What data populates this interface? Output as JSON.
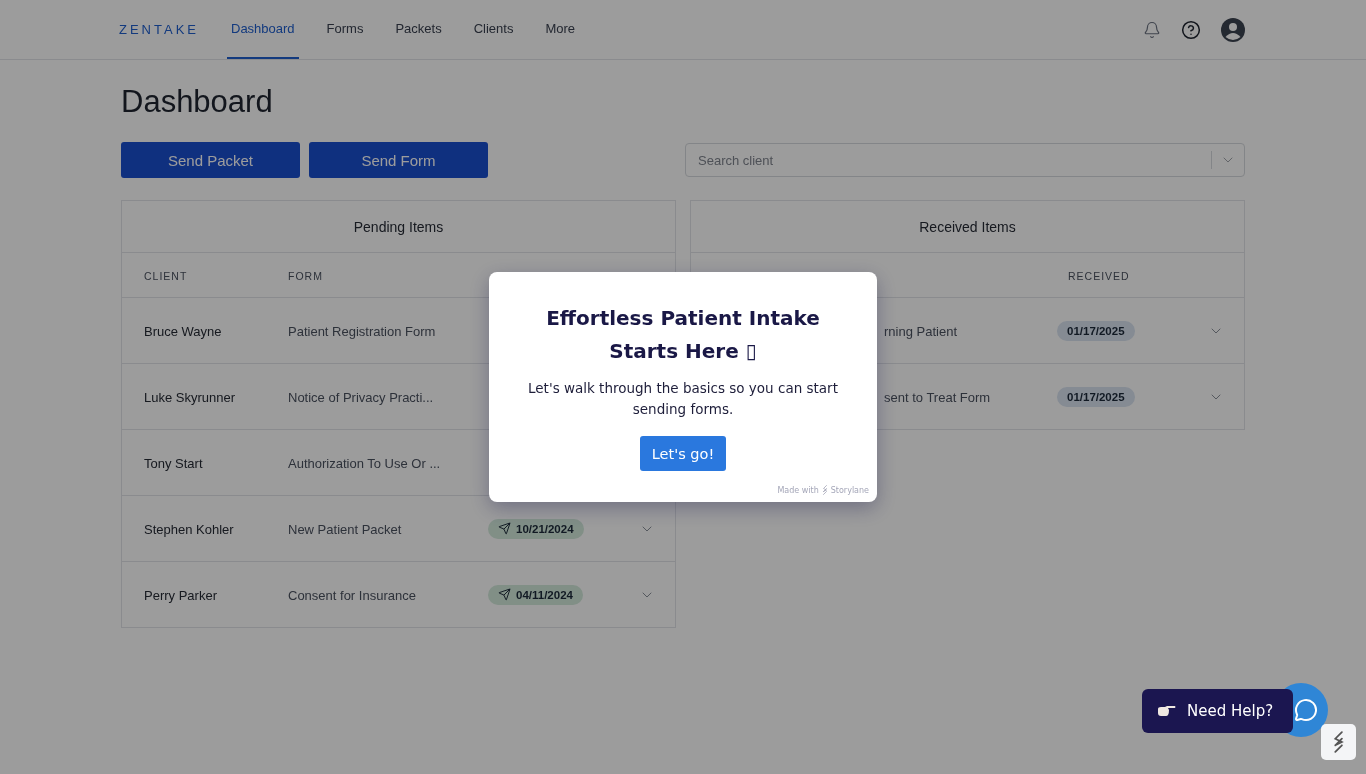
{
  "nav": {
    "logo": "ZENTAKE",
    "items": [
      {
        "label": "Dashboard",
        "selected": true
      },
      {
        "label": "Forms",
        "selected": false
      },
      {
        "label": "Packets",
        "selected": false
      },
      {
        "label": "Clients",
        "selected": false
      },
      {
        "label": "More",
        "selected": false
      }
    ]
  },
  "page_title": "Dashboard",
  "buttons": [
    "Send Packet",
    "Send Form"
  ],
  "search": {
    "placeholder": "Search client"
  },
  "pending": {
    "title": "Pending Items",
    "client_header": "CLIENT",
    "form_header": "FORM",
    "rows": [
      {
        "client": "Bruce Wayne",
        "form": "Patient Registration Form"
      },
      {
        "client": "Luke Skyrunner",
        "form": "Notice of Privacy Practi..."
      },
      {
        "client": "Tony Start",
        "form": "Authorization To Use Or ..."
      },
      {
        "client": "Stephen Kohler",
        "form": "New Patient Packet",
        "date": "10/21/2024"
      },
      {
        "client": "Perry Parker",
        "form": "Consent for Insurance",
        "date": "04/11/2024"
      }
    ]
  },
  "received": {
    "title": "Received Items",
    "date_header": "RECEIVED",
    "rows": [
      {
        "form": "rning Patient",
        "date": "01/17/2025"
      },
      {
        "form": "sent to Treat Form",
        "date": "01/17/2025"
      }
    ]
  },
  "tour": {
    "title": "Effortless Patient Intake Starts Here ▯",
    "body": "Let's walk through the basics so you can start sending forms.",
    "button": "Let's go!",
    "footer": "Made with",
    "brand": "Storylane"
  },
  "help": {
    "label": "Need Help?"
  }
}
